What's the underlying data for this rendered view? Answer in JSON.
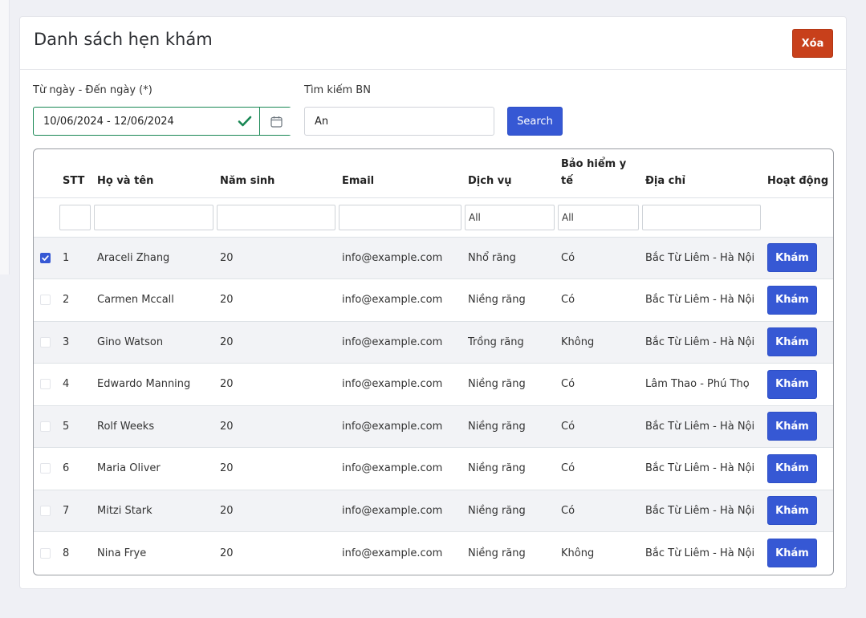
{
  "page": {
    "title": "Danh sách hẹn khám",
    "delete_label": "Xóa"
  },
  "filters": {
    "date_label": "Từ ngày - Đến ngày (*)",
    "date_value": "10/06/2024 - 12/06/2024",
    "search_label": "Tìm kiếm BN",
    "search_value": "An",
    "search_button": "Search"
  },
  "table": {
    "headers": {
      "stt": "STT",
      "name": "Họ và tên",
      "birth": "Năm sinh",
      "email": "Email",
      "service": "Dịch vụ",
      "insurance": "Bảo hiểm y tế",
      "address": "Địa chỉ",
      "action": "Hoạt động"
    },
    "column_filters": {
      "service": "All",
      "insurance": "All"
    },
    "rows": [
      {
        "checked": true,
        "stt": "1",
        "name": "Araceli Zhang",
        "birth": "20",
        "email": "info@example.com",
        "service": "Nhổ răng",
        "insurance": "Có",
        "address": "Bắc Từ Liêm - Hà Nội",
        "action": "Khám"
      },
      {
        "checked": false,
        "stt": "2",
        "name": "Carmen Mccall",
        "birth": "20",
        "email": "info@example.com",
        "service": "Niềng răng",
        "insurance": "Có",
        "address": "Bắc Từ Liêm - Hà Nội",
        "action": "Khám"
      },
      {
        "checked": false,
        "stt": "3",
        "name": "Gino Watson",
        "birth": "20",
        "email": "info@example.com",
        "service": "Trồng răng",
        "insurance": "Không",
        "address": "Bắc Từ Liêm - Hà Nội",
        "action": "Khám"
      },
      {
        "checked": false,
        "stt": "4",
        "name": "Edwardo Manning",
        "birth": "20",
        "email": "info@example.com",
        "service": "Niềng răng",
        "insurance": "Có",
        "address": "Lâm Thao - Phú Thọ",
        "action": "Khám"
      },
      {
        "checked": false,
        "stt": "5",
        "name": "Rolf Weeks",
        "birth": "20",
        "email": "info@example.com",
        "service": "Niềng răng",
        "insurance": "Có",
        "address": "Bắc Từ Liêm - Hà Nội",
        "action": "Khám"
      },
      {
        "checked": false,
        "stt": "6",
        "name": "Maria Oliver",
        "birth": "20",
        "email": "info@example.com",
        "service": "Niềng răng",
        "insurance": "Có",
        "address": "Bắc Từ Liêm - Hà Nội",
        "action": "Khám"
      },
      {
        "checked": false,
        "stt": "7",
        "name": "Mitzi Stark",
        "birth": "20",
        "email": "info@example.com",
        "service": "Niềng răng",
        "insurance": "Có",
        "address": "Bắc Từ Liêm - Hà Nội",
        "action": "Khám"
      },
      {
        "checked": false,
        "stt": "8",
        "name": "Nina Frye",
        "birth": "20",
        "email": "info@example.com",
        "service": "Niềng răng",
        "insurance": "Không",
        "address": "Bắc Từ Liêm - Hà Nội",
        "action": "Khám"
      }
    ]
  },
  "colors": {
    "primary": "#3658d4",
    "danger": "#c8401b",
    "success": "#198754"
  }
}
